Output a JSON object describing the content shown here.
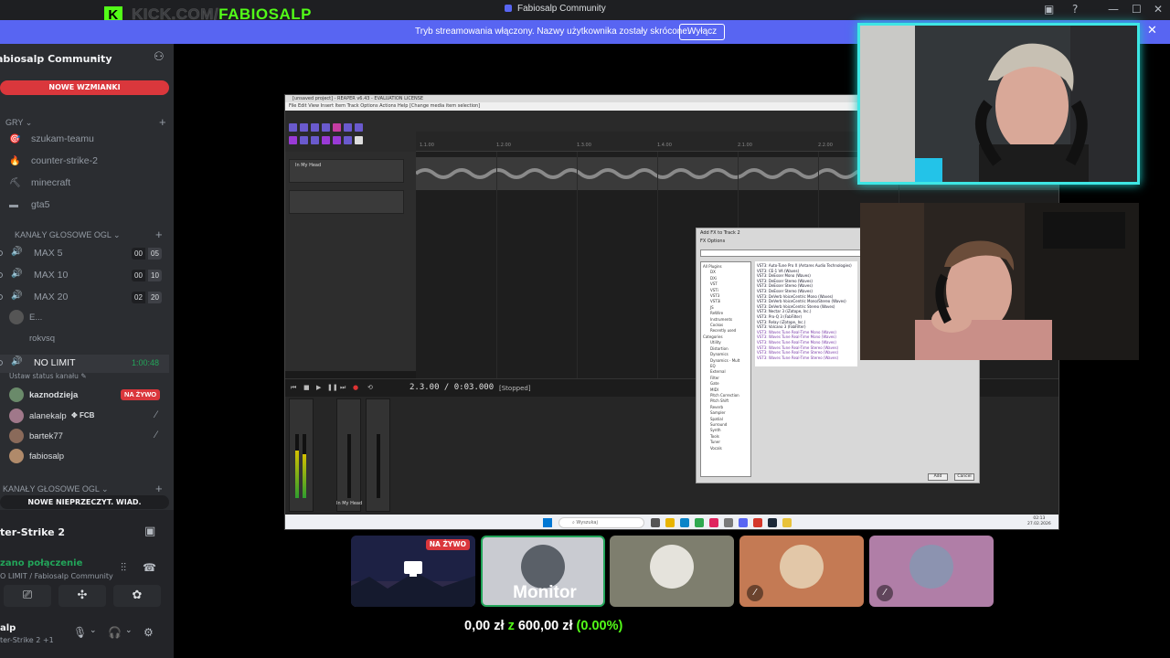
{
  "window": {
    "title": "Fabiosalp Community",
    "brand_letter": "K",
    "brand_host": "KICK.COM/",
    "brand_user": "FABIOSALP"
  },
  "banner": {
    "text": "Tryb streamowania włączony. Nazwy użytkownika zostały skrócone.",
    "button": "Wyłącz"
  },
  "sidebar": {
    "server_name": "abiosalp Community",
    "mentions_pill": "NOWE WZMIANKI",
    "categories": {
      "games": "GRY",
      "voice1": "KANAŁY GŁOSOWE OGL",
      "voice2": "KANAŁY GŁOSOWE OGL"
    },
    "text_channels": [
      {
        "label": "szukam-teamu",
        "icon": "🎯"
      },
      {
        "label": "counter-strike-2",
        "icon": "🔥"
      },
      {
        "label": "minecraft",
        "icon": "⛏"
      },
      {
        "label": "gta5",
        "icon": "▬"
      }
    ],
    "voice_channels": [
      {
        "label": "MAX 5",
        "count_a": "00",
        "count_b": "05"
      },
      {
        "label": "MAX 10",
        "count_a": "00",
        "count_b": "10"
      },
      {
        "label": "MAX 20",
        "count_a": "02",
        "count_b": "20"
      }
    ],
    "collapsed_users": [
      "E...",
      "rokvsq"
    ],
    "no_limit": {
      "label": "NO LIMIT",
      "timer": "1:00:48",
      "status": "Ustaw status kanału"
    },
    "members": [
      {
        "name": "kaznodzieja",
        "live": "NA ŻYWO"
      },
      {
        "name": "alanekalp",
        "tag": "FCB"
      },
      {
        "name": "bartek77"
      },
      {
        "name": "fabiosalp"
      }
    ],
    "unread_pill": "NOWE NIEPRZECZYT. WIAD.",
    "voice_panel": {
      "title": "ter-Strike 2",
      "status": "zano połączenie",
      "sub": "O LIMIT / Fabiosalp Community"
    },
    "user": {
      "name": "alp",
      "sub": "ter-Strike 2 +1"
    }
  },
  "daw": {
    "title": "[unsaved project] - REAPER v6.43 - EVALUATION LICENSE",
    "menu": "File  Edit  View  Insert  Item  Track  Options  Actions  Help    [Change media item selection]",
    "track1": "In My Head",
    "time": "2.3.00 / 0:03.000",
    "state": "[Stopped]",
    "mixer_name": "In My Head",
    "fx_title": "Add FX to Track 2",
    "fx_menu": "FX    Options",
    "fx_tree": [
      "All Plugins",
      "DX",
      "DXi",
      "VST",
      "VSTi",
      "VST3",
      "VST3i",
      "JS",
      "ReWire",
      "Instruments",
      "Cockos",
      "Recently used",
      "Categories",
      "Utility",
      "Distortion",
      "Dynamics",
      "Dynamics - Mult",
      "EQ",
      "External",
      "Filter",
      "Gate",
      "MIDI",
      "Pitch Correction",
      "Pitch Shift",
      "Reverb",
      "Sampler",
      "Spatial",
      "Surround",
      "Synth",
      "Tools",
      "Tuner",
      "Vocals"
    ],
    "fx_list": [
      "VST3: Auto-Tune Pro X (Antares Audio Technologies)",
      "VST3: CE-1 VA (Waves)",
      "VST3: DeEsser Mono (Waves)",
      "VST3: DeEsser Stereo (Waves)",
      "VST3: DeEsser Stereo (Waves)",
      "VST3: DeEsser Stereo (Waves)",
      "VST3: DeVerb VoiceCentric Mono (Waves)",
      "VST3: DeVerb VoiceCentric Mono/Stereo (Waves)",
      "VST3: DeVerb VoiceCentric Stereo (Waves)",
      "VST3: Nectar 3 (iZotope, Inc.)",
      "VST3: Pro-Q 3 (FabFilter)",
      "VST3: Relay (iZotope, Inc.)",
      "VST3: Volcano 3 (FabFilter)",
      "VST3: Waves Tune Real-Time Mono (Waves)",
      "VST3: Waves Tune Real-Time Mono (Waves)",
      "VST3: Waves Tune Real-Time Mono (Waves)",
      "VST3: Waves Tune Real-Time Stereo (Waves)",
      "VST3: Waves Tune Real-Time Stereo (Waves)",
      "VST3: Waves Tune Real-Time Stereo (Waves)"
    ],
    "fx_add": "Add",
    "fx_cancel": "Cancel",
    "taskbar_search": "Wyszukaj",
    "clock_time": "02:13",
    "clock_date": "27.02.2026"
  },
  "tiles": [
    {
      "live": "NA ŻYWO"
    },
    {
      "label": "Monitor"
    },
    {},
    {},
    {}
  ],
  "goal": {
    "current": "0,00 zł",
    "of": "z",
    "target": "600,00 zł",
    "percent": "(0.00%)"
  },
  "colors": {
    "accent": "#5865f2",
    "live_red": "#da373c",
    "kick_green": "#53fc18",
    "cam_border": "#3ee6e4"
  }
}
